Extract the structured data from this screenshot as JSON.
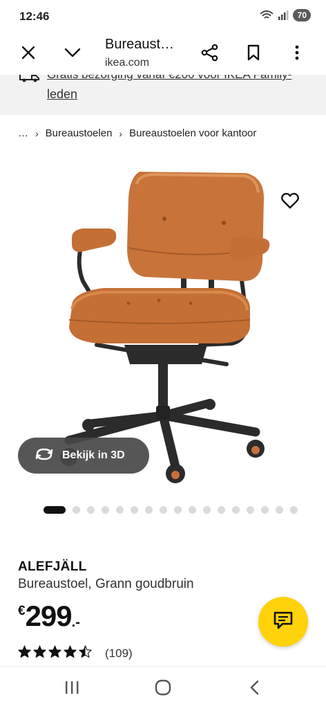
{
  "status_bar": {
    "time": "12:46",
    "battery": "70"
  },
  "browser": {
    "title": "Bureaust…",
    "domain": "ikea.com"
  },
  "promo": {
    "cut_text": "Gratis bezorging vanaf €200 voor IKEA Family-",
    "link_text": "leden"
  },
  "breadcrumb": {
    "ellipsis": "…",
    "items": [
      "Bureaustoelen",
      "Bureaustoelen voor kantoor"
    ]
  },
  "gallery": {
    "view_3d_label": "Bekijk in 3D",
    "image_count": 17,
    "active_index": 0
  },
  "product": {
    "name": "ALEFJÄLL",
    "description": "Bureaustoel, Grann goudbruin",
    "price_currency": "€",
    "price_integer": "299",
    "price_decimals": ".-",
    "rating_value": 4.5,
    "rating_max": 5,
    "rating_count": "(109)"
  },
  "icons": {
    "close": "close-icon",
    "collapse": "chevron-down-icon",
    "share": "share-icon",
    "bookmark": "bookmark-icon",
    "menu": "more-vert-icon",
    "favorite": "heart-icon",
    "rotate": "rotate-3d-icon",
    "chat": "chat-icon",
    "truck": "truck-icon"
  },
  "colors": {
    "accent_yellow": "#FFD20A",
    "leather": "#C87438",
    "frame": "#2B2B2B"
  }
}
